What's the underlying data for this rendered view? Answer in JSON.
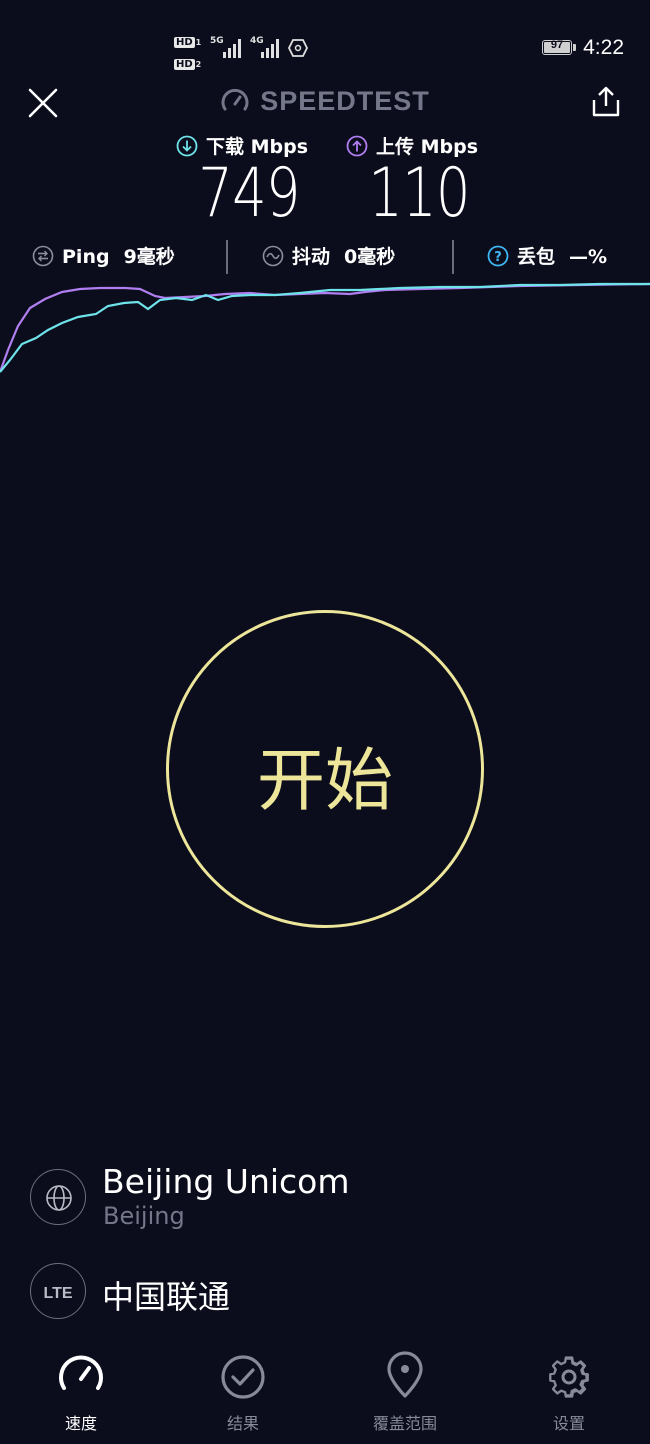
{
  "status_bar": {
    "sim1": "HD",
    "sim1_num": "1",
    "sim2": "HD",
    "sim2_num": "2",
    "net1": "5G",
    "net2": "4G",
    "battery": "97",
    "time": "4:22"
  },
  "header": {
    "brand": "SPEEDTEST"
  },
  "metrics": {
    "download_label": "下载 Mbps",
    "download_value": "749",
    "upload_label": "上传 Mbps",
    "upload_value": "110"
  },
  "stats": {
    "ping_label": "Ping",
    "ping_value": "9毫秒",
    "jitter_label": "抖动",
    "jitter_value": "0毫秒",
    "loss_label": "丢包",
    "loss_value": "—%"
  },
  "colors": {
    "background": "#0b0d1c",
    "download_line": "#6fe3ea",
    "upload_line": "#b07ef0",
    "go_accent": "#ece59a",
    "nav_inactive": "#878a99"
  },
  "go_button": {
    "label": "开始"
  },
  "server": {
    "name": "Beijing Unicom",
    "location": "Beijing",
    "connection_type": "LTE",
    "isp": "中国联通"
  },
  "nav": {
    "items": [
      {
        "label": "速度",
        "icon": "speedometer-icon",
        "active": true
      },
      {
        "label": "结果",
        "icon": "checkmark-circle-icon",
        "active": false
      },
      {
        "label": "覆盖范围",
        "icon": "map-pin-icon",
        "active": false
      },
      {
        "label": "设置",
        "icon": "gear-icon",
        "active": false
      }
    ]
  }
}
